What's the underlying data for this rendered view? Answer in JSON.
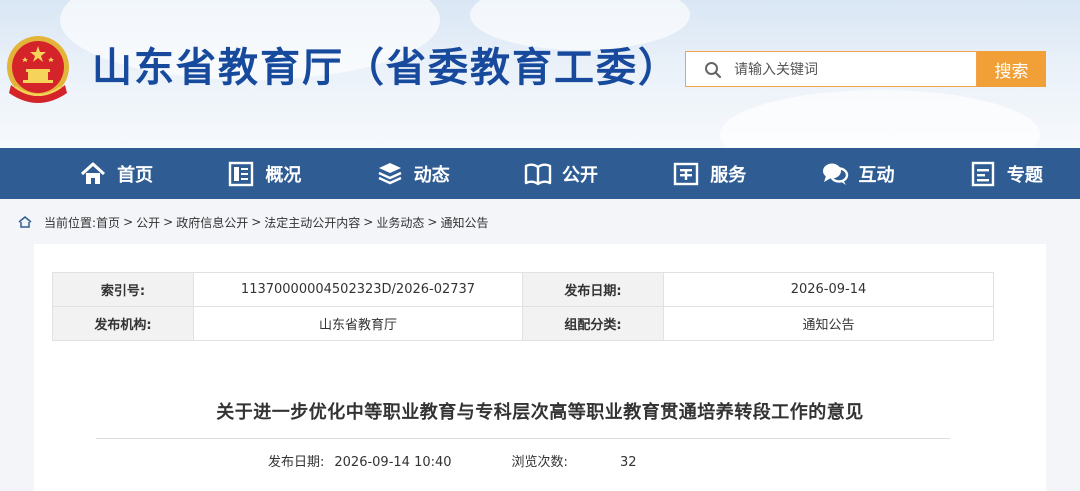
{
  "header": {
    "site_title": "山东省教育厅（省委教育工委）",
    "search_placeholder": "请输入关键词",
    "search_button": "搜索"
  },
  "nav": {
    "items": [
      {
        "label": "首页",
        "icon": "home-icon"
      },
      {
        "label": "概况",
        "icon": "overview-icon"
      },
      {
        "label": "动态",
        "icon": "news-stack-icon"
      },
      {
        "label": "公开",
        "icon": "open-book-icon"
      },
      {
        "label": "服务",
        "icon": "service-icon"
      },
      {
        "label": "互动",
        "icon": "chat-bubble-icon"
      },
      {
        "label": "专题",
        "icon": "topic-document-icon"
      }
    ]
  },
  "breadcrumb": {
    "prefix": "当前位置:",
    "items": [
      "首页",
      "公开",
      "政府信息公开",
      "法定主动公开内容",
      "业务动态",
      "通知公告"
    ],
    "separator": ">"
  },
  "meta_table": {
    "index_label": "索引号:",
    "index_value": "11370000004502323D/2026-02737",
    "publish_date_label": "发布日期:",
    "publish_date_value": "2026-09-14",
    "agency_label": "发布机构:",
    "agency_value": "山东省教育厅",
    "category_label": "组配分类:",
    "category_value": "通知公告"
  },
  "article": {
    "title": "关于进一步优化中等职业教育与专科层次高等职业教育贯通培养转段工作的意见",
    "date_label": "发布日期:",
    "date_value": "2026-09-14 10:40",
    "views_label": "浏览次数:",
    "views_value": "32"
  },
  "colors": {
    "nav_bg": "#2f5d93",
    "title_blue": "#174a9c",
    "search_accent": "#f0a036"
  }
}
